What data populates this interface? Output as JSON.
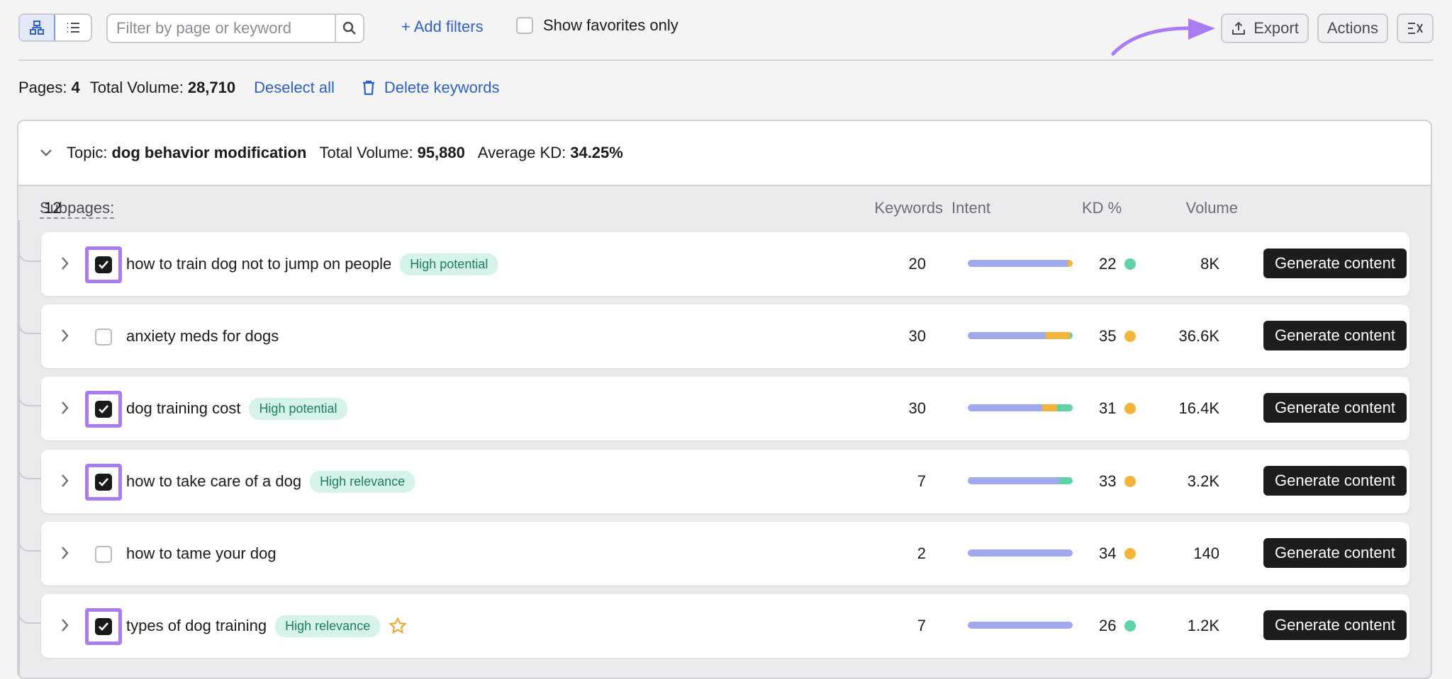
{
  "toolbar": {
    "search_placeholder": "Filter by page or keyword",
    "add_filters": "+ Add filters",
    "show_favorites": "Show favorites only",
    "export": "Export",
    "actions": "Actions"
  },
  "summary": {
    "pages_label": "Pages:",
    "pages_value": "4",
    "total_volume_label": "Total Volume:",
    "total_volume_value": "28,710",
    "deselect_all": "Deselect all",
    "delete_keywords": "Delete keywords"
  },
  "topic": {
    "label": "Topic:",
    "name": "dog behavior modification",
    "total_volume_label": "Total Volume:",
    "total_volume_value": "95,880",
    "avg_kd_label": "Average KD:",
    "avg_kd_value": "34.25%"
  },
  "table": {
    "subpages_label": "Subpages:",
    "subpages_count": "12",
    "columns": {
      "keywords": "Keywords",
      "intent": "Intent",
      "kd": "KD %",
      "volume": "Volume"
    },
    "button_label": "Generate content",
    "rows": [
      {
        "keyword": "how to train dog not to jump on people",
        "badge": "High potential",
        "checked": true,
        "keywords": "20",
        "kd": "22",
        "kd_color": "#5fd3a6",
        "volume": "8K",
        "intent": [
          {
            "pct": 95,
            "color": "#a0a9ec"
          },
          {
            "pct": 5,
            "color": "#f3b43c"
          }
        ]
      },
      {
        "keyword": "anxiety meds for dogs",
        "badge": "",
        "checked": false,
        "keywords": "30",
        "kd": "35",
        "kd_color": "#f3b43c",
        "volume": "36.6K",
        "intent": [
          {
            "pct": 74,
            "color": "#a0a9ec"
          },
          {
            "pct": 23,
            "color": "#f3b43c"
          },
          {
            "pct": 3,
            "color": "#5fd3a6"
          }
        ]
      },
      {
        "keyword": "dog training cost",
        "badge": "High potential",
        "checked": true,
        "keywords": "30",
        "kd": "31",
        "kd_color": "#f3b43c",
        "volume": "16.4K",
        "intent": [
          {
            "pct": 71,
            "color": "#a0a9ec"
          },
          {
            "pct": 14,
            "color": "#f3b43c"
          },
          {
            "pct": 15,
            "color": "#5fd3a6"
          }
        ]
      },
      {
        "keyword": "how to take care of a dog",
        "badge": "High relevance",
        "checked": true,
        "keywords": "7",
        "kd": "33",
        "kd_color": "#f3b43c",
        "volume": "3.2K",
        "intent": [
          {
            "pct": 87,
            "color": "#a0a9ec"
          },
          {
            "pct": 13,
            "color": "#5fd3a6"
          }
        ]
      },
      {
        "keyword": "how to tame your dog",
        "badge": "",
        "checked": false,
        "keywords": "2",
        "kd": "34",
        "kd_color": "#f3b43c",
        "volume": "140",
        "intent": [
          {
            "pct": 100,
            "color": "#a0a9ec"
          }
        ]
      },
      {
        "keyword": "types of dog training",
        "badge": "High relevance",
        "checked": true,
        "favorite": true,
        "keywords": "7",
        "kd": "26",
        "kd_color": "#5fd3a6",
        "volume": "1.2K",
        "intent": [
          {
            "pct": 100,
            "color": "#a0a9ec"
          }
        ]
      }
    ]
  }
}
